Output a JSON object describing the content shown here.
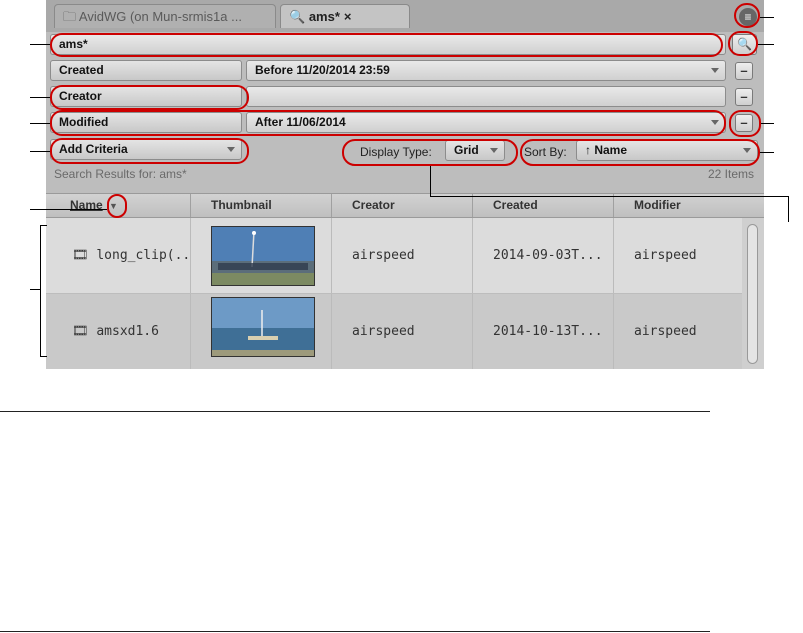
{
  "tabs": [
    {
      "label": "AvidWG (on Mun-srmis1a ...",
      "icon": "folder-icon",
      "active": false
    },
    {
      "label": "ams*",
      "icon": "search-icon",
      "active": true,
      "close": "×"
    }
  ],
  "menu_icon": "menu-icon",
  "search": {
    "value": "ams*",
    "button_icon": "search-icon"
  },
  "criteria": [
    {
      "label": "Created",
      "value": "Before 11/20/2014 23:59",
      "has_dropdown": true,
      "remove": "–"
    },
    {
      "label": "Creator",
      "value": "",
      "has_dropdown": false,
      "remove": "–"
    },
    {
      "label": "Modified",
      "value": "After 11/06/2014",
      "has_dropdown": true,
      "remove": "–"
    }
  ],
  "add_criteria": {
    "label": "Add Criteria"
  },
  "display_type": {
    "label": "Display Type:",
    "value": "Grid"
  },
  "sort_by": {
    "label": "Sort By:",
    "value": "Name",
    "direction_icon": "arrow-up-icon",
    "direction_glyph": "↑"
  },
  "results": {
    "label": "Search Results for: ams*",
    "count": "22 Items"
  },
  "table": {
    "columns": [
      "Name",
      "Thumbnail",
      "Creator",
      "Created",
      "Modifier"
    ],
    "rows": [
      {
        "name": "long_clip(...",
        "creator": "airspeed",
        "created": "2014-09-03T...",
        "modifier": "airspeed",
        "icon": "clip-icon"
      },
      {
        "name": "amsxd1.6",
        "creator": "airspeed",
        "created": "2014-10-13T...",
        "modifier": "airspeed",
        "icon": "clip-icon"
      }
    ]
  },
  "colors": {
    "callout": "#cc0000",
    "panel": "#bdbdbd",
    "tab_bar": "#a9a9a9"
  }
}
